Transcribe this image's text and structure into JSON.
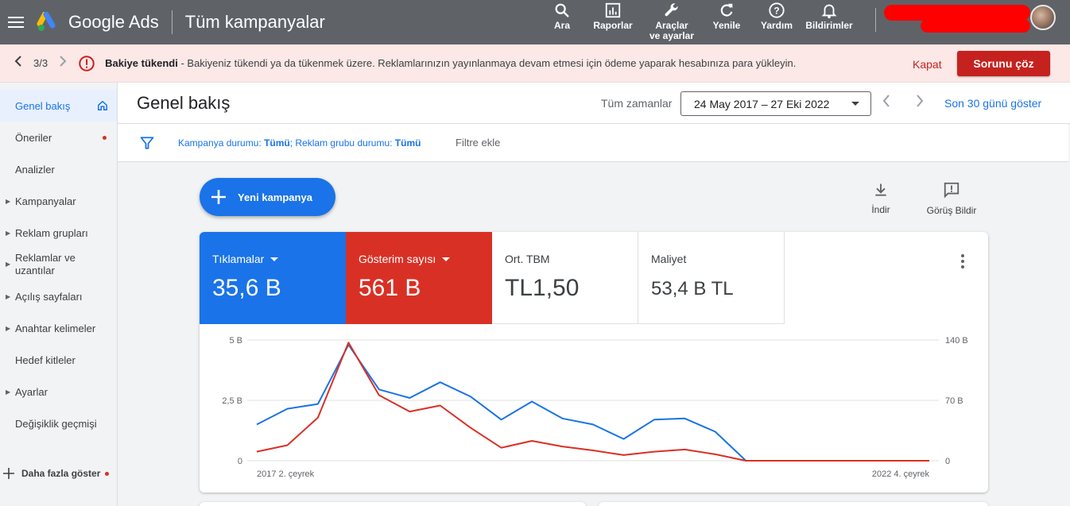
{
  "app": {
    "name": "Google Ads",
    "page_heading": "Tüm kampanyalar"
  },
  "top_actions": [
    {
      "label": "Ara",
      "icon": "search-icon"
    },
    {
      "label": "Raporlar",
      "icon": "reports-icon"
    },
    {
      "label": "Araçlar\nve ayarlar",
      "icon": "tools-icon"
    },
    {
      "label": "Yenile",
      "icon": "refresh-icon"
    },
    {
      "label": "Yardım",
      "icon": "help-icon"
    },
    {
      "label": "Bildirimler",
      "icon": "bell-icon"
    }
  ],
  "alert": {
    "count": "3/3",
    "title": "Bakiye tükendi",
    "message": " - Bakiyeniz tükendi ya da tükenmek üzere. Reklamlarınızın yayınlanmaya devam etmesi için ödeme yaparak hesabınıza para yükleyin.",
    "dismiss_label": "Kapat",
    "fix_label": "Sorunu çöz",
    "color": "#c5221f"
  },
  "sidebar": {
    "items": [
      {
        "label": "Genel bakış",
        "active": true,
        "expandable": false,
        "dot": false
      },
      {
        "label": "Öneriler",
        "active": false,
        "expandable": false,
        "dot": true
      },
      {
        "label": "Analizler",
        "active": false,
        "expandable": false,
        "dot": false
      },
      {
        "label": "Kampanyalar",
        "active": false,
        "expandable": true,
        "dot": false
      },
      {
        "label": "Reklam grupları",
        "active": false,
        "expandable": true,
        "dot": false
      },
      {
        "label": "Reklamlar ve uzantılar",
        "active": false,
        "expandable": true,
        "dot": false
      },
      {
        "label": "Açılış sayfaları",
        "active": false,
        "expandable": true,
        "dot": false
      },
      {
        "label": "Anahtar kelimeler",
        "active": false,
        "expandable": true,
        "dot": false
      },
      {
        "label": "Hedef kitleler",
        "active": false,
        "expandable": false,
        "dot": false
      },
      {
        "label": "Ayarlar",
        "active": false,
        "expandable": true,
        "dot": false
      },
      {
        "label": "Değişiklik geçmişi",
        "active": false,
        "expandable": false,
        "dot": false
      }
    ],
    "more_label": "Daha fazla göster"
  },
  "header": {
    "title": "Genel bakış",
    "range_label": "Tüm zamanlar",
    "date_range": "24 May 2017 – 27 Eki 2022",
    "last30_label": "Son 30 günü göster"
  },
  "filters": {
    "campaign_status_label": "Kampanya durumu: ",
    "campaign_status_value": "Tümü",
    "adgroup_status_label": "; Reklam grubu durumu: ",
    "adgroup_status_value": "Tümü",
    "add_filter_label": "Filtre ekle"
  },
  "actions": {
    "new_campaign_label": "Yeni kampanya",
    "download_label": "İndir",
    "feedback_label": "Görüş Bildir"
  },
  "metrics": [
    {
      "label": "Tıklamalar",
      "value": "35,6 B",
      "color": "#1a73e8",
      "selected": true
    },
    {
      "label": "Gösterim sayısı",
      "value": "561 B",
      "color": "#d93025",
      "selected": true
    },
    {
      "label": "Ort. TBM",
      "value": "TL1,50",
      "selected": false
    },
    {
      "label": "Maliyet",
      "value": "53,4 B TL",
      "selected": false
    }
  ],
  "chart_data": {
    "type": "line",
    "x_start_label": "2017 2. çeyrek",
    "x_end_label": "2022 4. çeyrek",
    "left_axis": {
      "ticks": [
        "5 B",
        "2,5 B",
        "0"
      ],
      "ylim": [
        0,
        5000
      ]
    },
    "right_axis": {
      "ticks": [
        "140 B",
        "70 B",
        "0"
      ],
      "ylim": [
        0,
        140000
      ]
    },
    "grid": true,
    "series": [
      {
        "name": "Tıklamalar",
        "axis": "left",
        "color": "#1a73e8",
        "values": [
          1500,
          2150,
          2350,
          4800,
          2950,
          2600,
          3250,
          2650,
          1700,
          2450,
          1750,
          1500,
          900,
          1700,
          1750,
          1200,
          0,
          0,
          0,
          0,
          0,
          0,
          0
        ]
      },
      {
        "name": "Gösterim sayısı",
        "axis": "right",
        "color": "#d93025",
        "values": [
          10500,
          18000,
          50000,
          137000,
          76000,
          57000,
          64000,
          38000,
          15000,
          23000,
          16500,
          12000,
          6500,
          10500,
          13000,
          7500,
          0,
          0,
          0,
          0,
          0,
          0,
          0
        ]
      }
    ]
  }
}
